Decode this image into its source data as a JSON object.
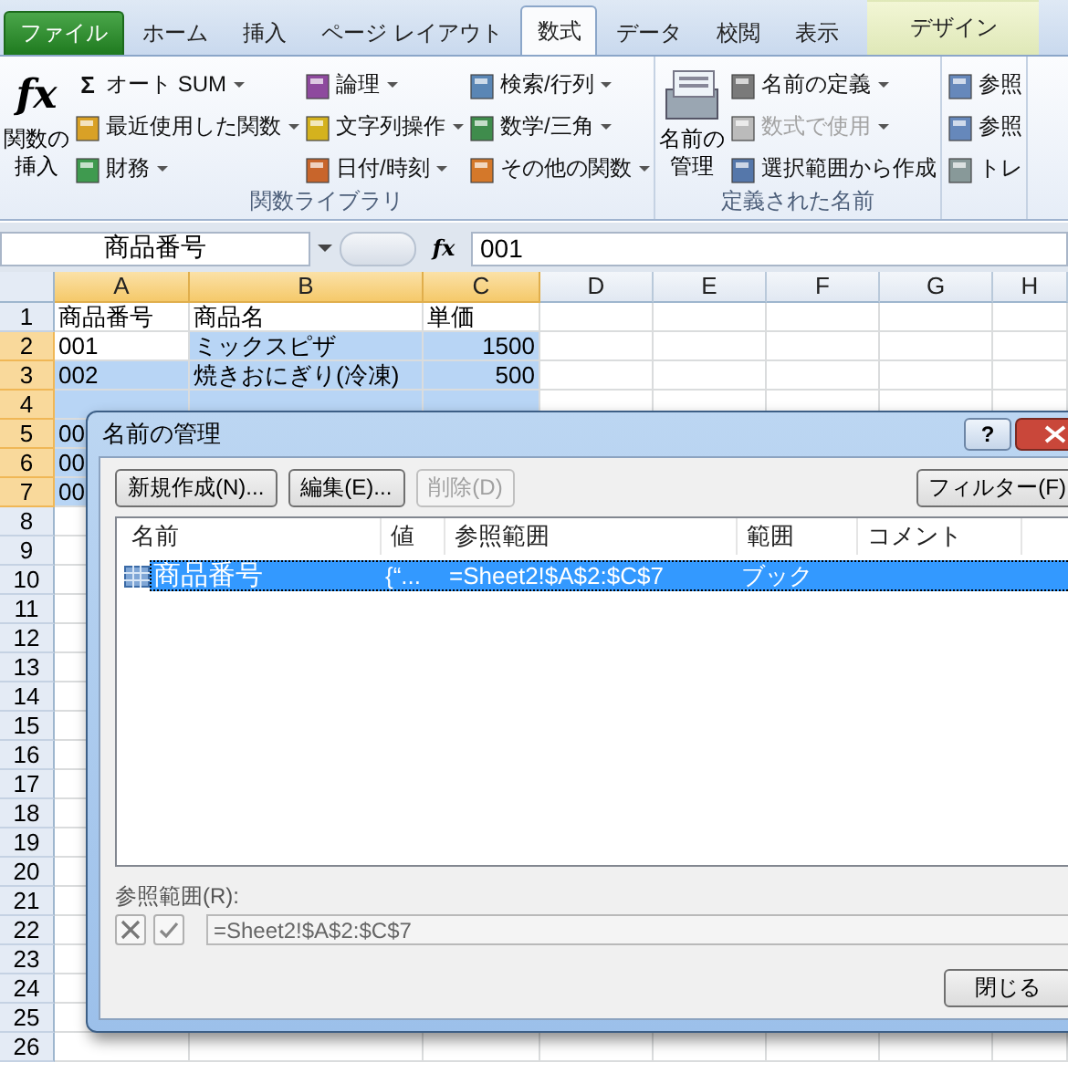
{
  "tabs": [
    {
      "label": "ファイル",
      "kind": "file",
      "selected": false
    },
    {
      "label": "ホーム",
      "kind": "normal",
      "selected": false
    },
    {
      "label": "挿入",
      "kind": "normal",
      "selected": false
    },
    {
      "label": "ページ レイアウト",
      "kind": "normal",
      "selected": false
    },
    {
      "label": "数式",
      "kind": "normal",
      "selected": true
    },
    {
      "label": "データ",
      "kind": "normal",
      "selected": false
    },
    {
      "label": "校閲",
      "kind": "normal",
      "selected": false
    },
    {
      "label": "表示",
      "kind": "normal",
      "selected": false
    },
    {
      "label": "デザイン",
      "kind": "contextual",
      "selected": false
    }
  ],
  "ribbon": {
    "groups": [
      {
        "label": "関数ライブラリ",
        "large": {
          "symbol": "fx",
          "label": "関数の挿入"
        },
        "columns": [
          [
            {
              "symbol": "Σ",
              "label": "オート SUM",
              "dropdown": true,
              "disabled": false
            },
            {
              "label": "最近使用した関数",
              "dropdown": true,
              "disabled": false
            },
            {
              "label": "財務",
              "dropdown": true,
              "disabled": false
            }
          ],
          [
            {
              "label": "論理",
              "dropdown": true,
              "disabled": false
            },
            {
              "label": "文字列操作",
              "dropdown": true,
              "disabled": false
            },
            {
              "label": "日付/時刻",
              "dropdown": true,
              "disabled": false
            }
          ],
          [
            {
              "label": "検索/行列",
              "dropdown": true,
              "disabled": false
            },
            {
              "label": "数学/三角",
              "dropdown": true,
              "disabled": false
            },
            {
              "label": "その他の関数",
              "dropdown": true,
              "disabled": false
            }
          ]
        ]
      },
      {
        "label": "定義された名前",
        "large": {
          "label": "名前の管理"
        },
        "columns": [
          [
            {
              "label": "名前の定義",
              "dropdown": true,
              "disabled": false
            },
            {
              "label": "数式で使用",
              "dropdown": true,
              "disabled": true
            },
            {
              "label": "選択範囲から作成",
              "dropdown": false,
              "disabled": false
            }
          ]
        ]
      },
      {
        "columns": [
          [
            {
              "label": "参照",
              "dropdown": false,
              "disabled": false
            },
            {
              "label": "参照",
              "dropdown": false,
              "disabled": false
            },
            {
              "label": "トレ",
              "dropdown": false,
              "disabled": false
            }
          ]
        ]
      }
    ]
  },
  "formula_bar": {
    "name_box": "商品番号",
    "fx": "fx",
    "value": "001"
  },
  "sheet": {
    "columns": [
      {
        "label": "A",
        "selected": true
      },
      {
        "label": "B",
        "selected": true
      },
      {
        "label": "C",
        "selected": true
      },
      {
        "label": "D",
        "selected": false
      },
      {
        "label": "E",
        "selected": false
      },
      {
        "label": "F",
        "selected": false
      },
      {
        "label": "G",
        "selected": false
      },
      {
        "label": "H",
        "selected": false
      }
    ],
    "rows": [
      {
        "label": "1",
        "selected": false,
        "cells": [
          {
            "text": "商品番号",
            "kind": "text",
            "selected": false
          },
          {
            "text": "商品名",
            "kind": "text",
            "selected": false
          },
          {
            "text": "単価",
            "kind": "text",
            "selected": false
          }
        ]
      },
      {
        "label": "2",
        "selected": true,
        "cells": [
          {
            "text": "001",
            "kind": "text",
            "selected": false
          },
          {
            "text": "ミックスピザ",
            "kind": "text",
            "selected": true
          },
          {
            "text": "1500",
            "kind": "number",
            "selected": true
          }
        ]
      },
      {
        "label": "3",
        "selected": true,
        "cells": [
          {
            "text": "002",
            "kind": "text",
            "selected": true
          },
          {
            "text": "焼きおにぎり(冷凍)",
            "kind": "text",
            "selected": true
          },
          {
            "text": "500",
            "kind": "number",
            "selected": true
          }
        ]
      },
      {
        "label": "4",
        "selected": true,
        "cells": []
      },
      {
        "label": "5",
        "selected": true,
        "cells": [
          {
            "text": "00",
            "kind": "text",
            "selected": true
          }
        ]
      },
      {
        "label": "6",
        "selected": true,
        "cells": [
          {
            "text": "00",
            "kind": "text",
            "selected": true
          }
        ]
      },
      {
        "label": "7",
        "selected": true,
        "cells": [
          {
            "text": "00",
            "kind": "text",
            "selected": true
          }
        ]
      },
      {
        "label": "8",
        "selected": false,
        "cells": []
      },
      {
        "label": "9",
        "selected": false,
        "cells": []
      },
      {
        "label": "10",
        "selected": false,
        "cells": []
      },
      {
        "label": "11",
        "selected": false,
        "cells": []
      },
      {
        "label": "12",
        "selected": false,
        "cells": []
      },
      {
        "label": "13",
        "selected": false,
        "cells": []
      },
      {
        "label": "14",
        "selected": false,
        "cells": []
      },
      {
        "label": "15",
        "selected": false,
        "cells": []
      },
      {
        "label": "16",
        "selected": false,
        "cells": []
      },
      {
        "label": "17",
        "selected": false,
        "cells": []
      },
      {
        "label": "18",
        "selected": false,
        "cells": []
      },
      {
        "label": "19",
        "selected": false,
        "cells": []
      },
      {
        "label": "20",
        "selected": false,
        "cells": []
      },
      {
        "label": "21",
        "selected": false,
        "cells": []
      },
      {
        "label": "22",
        "selected": false,
        "cells": []
      },
      {
        "label": "23",
        "selected": false,
        "cells": []
      },
      {
        "label": "24",
        "selected": false,
        "cells": []
      },
      {
        "label": "25",
        "selected": false,
        "cells": []
      },
      {
        "label": "26",
        "selected": false,
        "cells": []
      }
    ]
  },
  "dialog": {
    "title": "名前の管理",
    "help": "?",
    "buttons": [
      {
        "label": "新規作成(N)...",
        "disabled": false
      },
      {
        "label": "編集(E)...",
        "disabled": false
      },
      {
        "label": "削除(D)",
        "disabled": true
      }
    ],
    "filter": "フィルター(F)",
    "list": {
      "columns": [
        "名前",
        "値",
        "参照範囲",
        "範囲",
        "コメント"
      ],
      "rows": [
        {
          "name": "商品番号",
          "value": "{“...",
          "refers_to": "=Sheet2!$A$2:$C$7",
          "scope": "ブック",
          "selected": true
        }
      ]
    },
    "refers_to": {
      "label": "参照範囲(R):",
      "value": "=Sheet2!$A$2:$C$7"
    },
    "close": "閉じる"
  }
}
